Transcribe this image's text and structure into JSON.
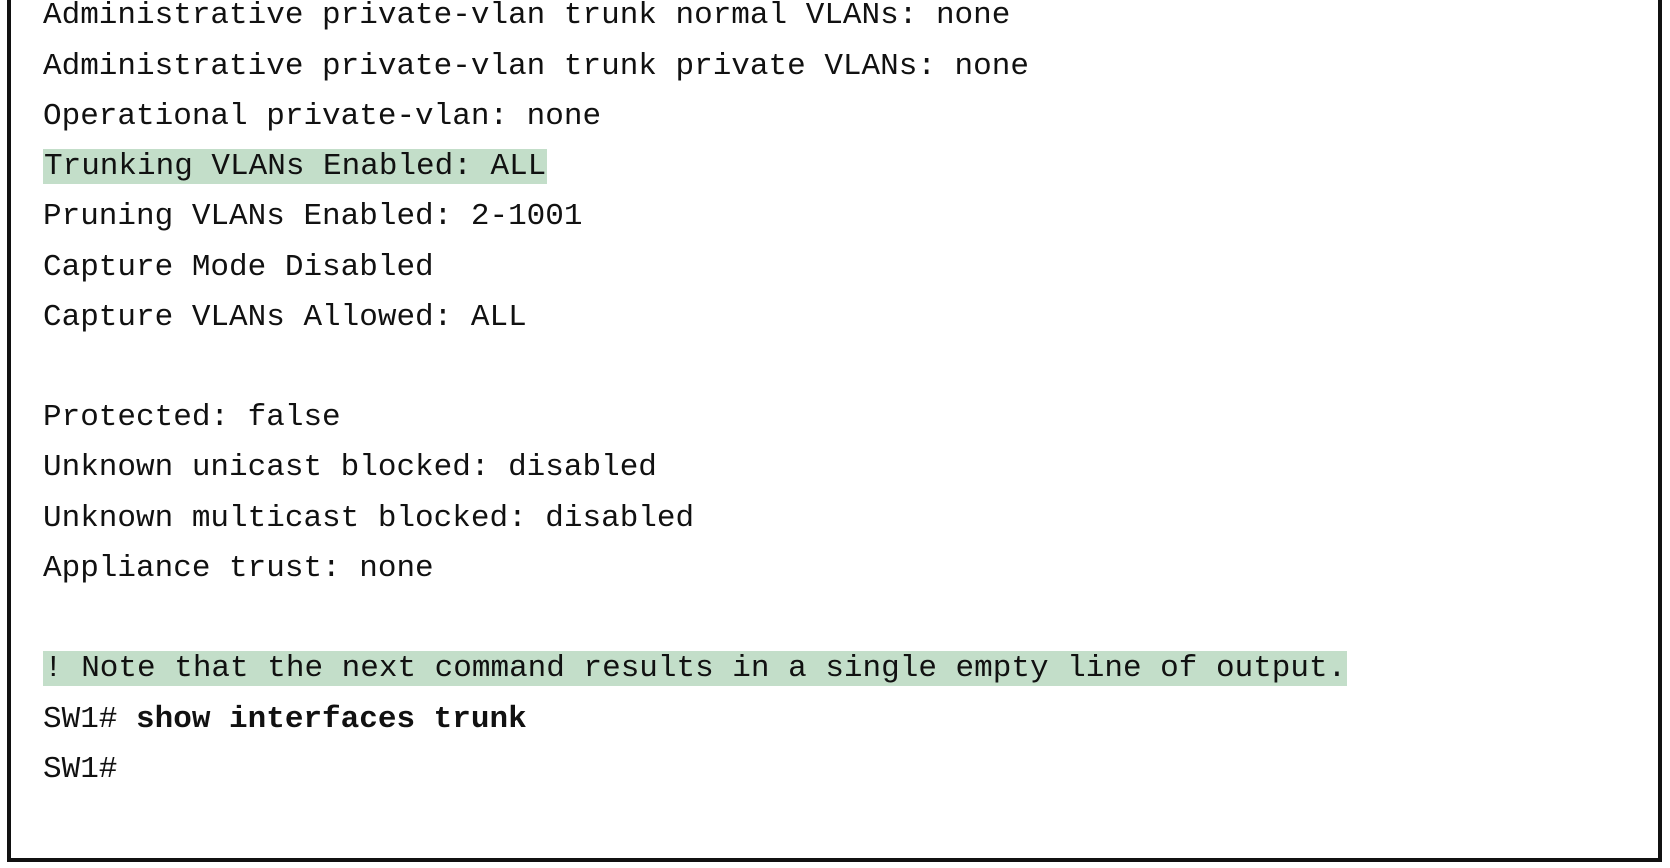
{
  "terminal": {
    "lines": {
      "l1": "Administrative private-vlan trunk normal VLANs: none",
      "l2": "Administrative private-vlan trunk private VLANs: none",
      "l3": "Operational private-vlan: none",
      "l4": "Trunking VLANs Enabled: ALL",
      "l5": "Pruning VLANs Enabled: 2-1001",
      "l6": "Capture Mode Disabled",
      "l7": "Capture VLANs Allowed: ALL",
      "l8": "Protected: false",
      "l9": "Unknown unicast blocked: disabled",
      "l10": "Unknown multicast blocked: disabled",
      "l11": "Appliance trust: none",
      "l12": "! Note that the next command results in a single empty line of output.",
      "l13_prompt": "SW1# ",
      "l13_command": "show interfaces trunk",
      "l14": "SW1#"
    },
    "highlight_color": "#c3dec9"
  }
}
